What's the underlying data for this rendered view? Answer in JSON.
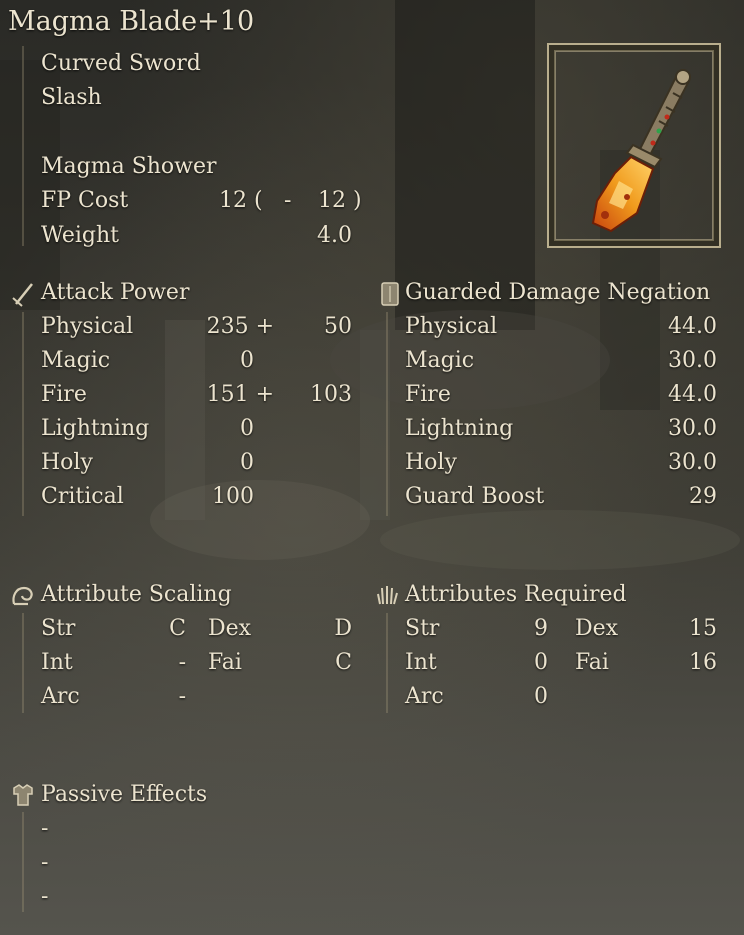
{
  "weapon": {
    "name": "Magma Blade+10",
    "type": "Curved Sword",
    "damage_type": "Slash",
    "skill": "Magma Shower",
    "fp_label": "FP Cost",
    "fp_open": "12 (",
    "fp_dash": "-",
    "fp_close": "12 )",
    "weight_label": "Weight",
    "weight_value": "4.0",
    "icon": "magma-blade-icon"
  },
  "attack": {
    "header": "Attack Power",
    "icon": "sword-icon",
    "rows": [
      {
        "label": "Physical",
        "base": "235 +",
        "bonus": "50"
      },
      {
        "label": "Magic",
        "base": "0",
        "bonus": ""
      },
      {
        "label": "Fire",
        "base": "151 +",
        "bonus": "103"
      },
      {
        "label": "Lightning",
        "base": "0",
        "bonus": ""
      },
      {
        "label": "Holy",
        "base": "0",
        "bonus": ""
      },
      {
        "label": "Critical",
        "base": "100",
        "bonus": ""
      }
    ]
  },
  "guard": {
    "header": "Guarded Damage Negation",
    "icon": "shield-icon",
    "rows": [
      {
        "label": "Physical",
        "value": "44.0"
      },
      {
        "label": "Magic",
        "value": "30.0"
      },
      {
        "label": "Fire",
        "value": "44.0"
      },
      {
        "label": "Lightning",
        "value": "30.0"
      },
      {
        "label": "Holy",
        "value": "30.0"
      },
      {
        "label": "Guard Boost",
        "value": "29"
      }
    ]
  },
  "scaling": {
    "header": "Attribute Scaling",
    "icon": "flexed-arm-icon",
    "rows": [
      {
        "l1": "Str",
        "v1": "C",
        "l2": "Dex",
        "v2": "D"
      },
      {
        "l1": "Int",
        "v1": "-",
        "l2": "Fai",
        "v2": "C"
      },
      {
        "l1": "Arc",
        "v1": "-",
        "l2": "",
        "v2": ""
      }
    ]
  },
  "required": {
    "header": "Attributes Required",
    "icon": "raised-hand-icon",
    "rows": [
      {
        "l1": "Str",
        "v1": "9",
        "l2": "Dex",
        "v2": "15"
      },
      {
        "l1": "Int",
        "v1": "0",
        "l2": "Fai",
        "v2": "16"
      },
      {
        "l1": "Arc",
        "v1": "0",
        "l2": "",
        "v2": ""
      }
    ]
  },
  "passive": {
    "header": "Passive Effects",
    "icon": "armor-icon",
    "items": [
      "-",
      "-",
      "-"
    ]
  }
}
